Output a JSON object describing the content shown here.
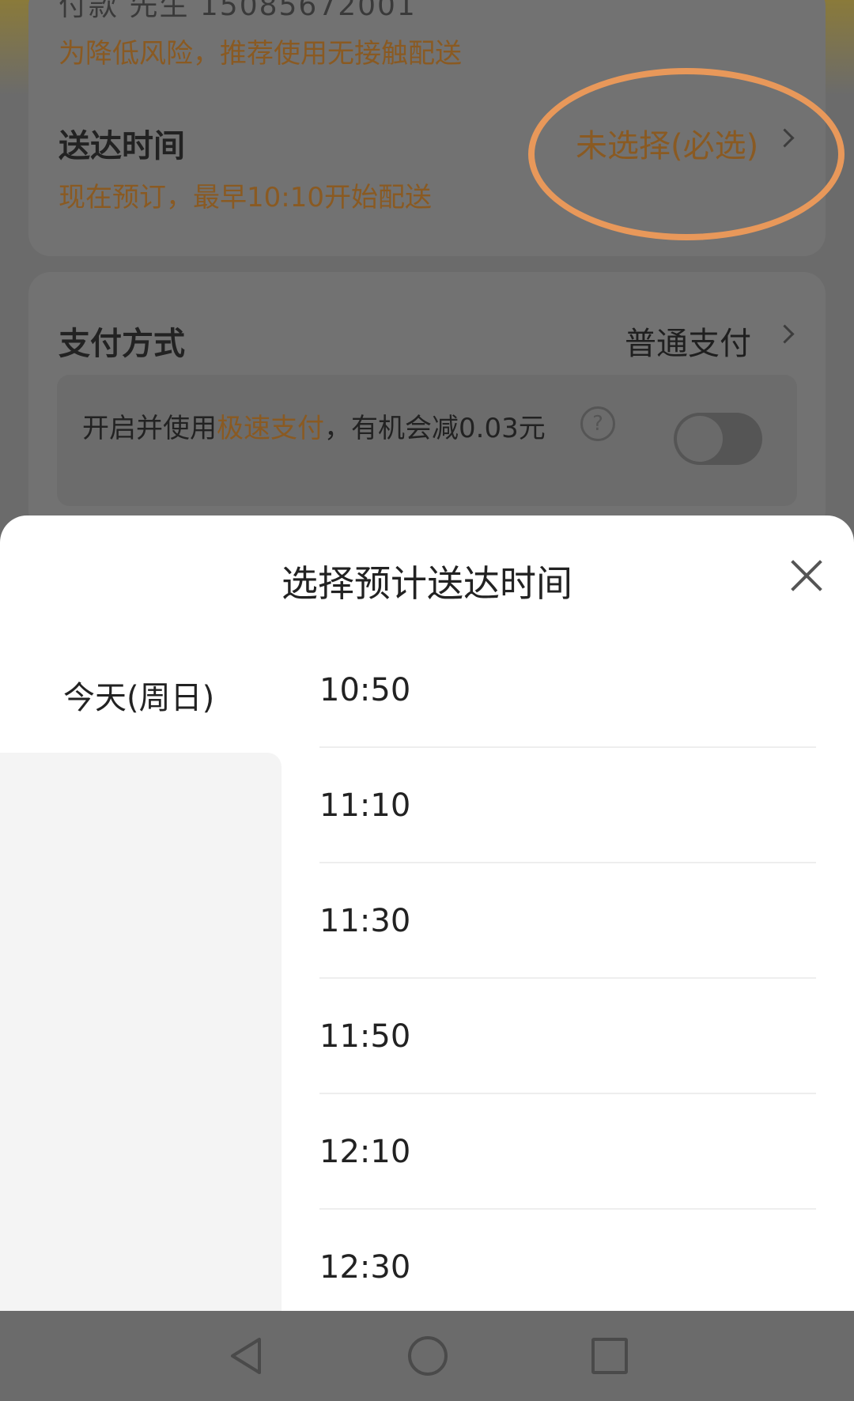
{
  "background": {
    "partial_top_text": "付款 先生 15085672001",
    "delivery": {
      "risk_tip": "为降低风险，推荐使用无接触配送",
      "title": "送达时间",
      "subtitle": "现在预订，最早10:10开始配送",
      "value": "未选择(必选)"
    },
    "payment": {
      "title": "支付方式",
      "value": "普通支付",
      "fastpay_prefix": "开启并使用",
      "fastpay_highlight": "极速支付",
      "fastpay_suffix": "，有机会减0.03元",
      "help_glyph": "?",
      "fastpay_enabled": false
    }
  },
  "sheet": {
    "title": "选择预计送达时间",
    "days": [
      {
        "label": "今天(周日)",
        "selected": true
      }
    ],
    "times": [
      "10:50",
      "11:10",
      "11:30",
      "11:50",
      "12:10",
      "12:30"
    ]
  },
  "nav": {
    "back_icon": "back-triangle-icon",
    "home_icon": "home-circle-icon",
    "recent_icon": "recent-square-icon"
  },
  "colors": {
    "accent": "#8a5a22",
    "highlight_ring": "#e8985a"
  }
}
